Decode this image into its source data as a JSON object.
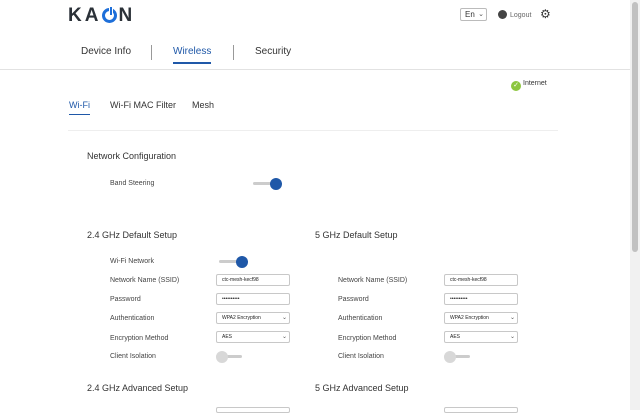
{
  "header": {
    "logo_text_1": "KA",
    "logo_text_2": "N",
    "language": "En",
    "logout": "Logout"
  },
  "nav": {
    "tabs": [
      "Device Info",
      "Wireless",
      "Security"
    ]
  },
  "status": {
    "internet": "Internet"
  },
  "subtabs": [
    "Wi-Fi",
    "Wi-Fi MAC Filter",
    "Mesh"
  ],
  "network_config": {
    "title": "Network Configuration",
    "band_steering_label": "Band Steering",
    "band_steering_on": true
  },
  "ghz24_default": {
    "title": "2.4 GHz Default Setup",
    "wifi_network_label": "Wi-Fi Network",
    "wifi_network_on": true,
    "ssid_label": "Network Name (SSID)",
    "ssid_value": "ctc-mesh-kecf98",
    "password_label": "Password",
    "password_value": "••••••••••",
    "auth_label": "Authentication",
    "auth_value": "WPA2 Encryption",
    "enc_label": "Encryption Method",
    "enc_value": "AES",
    "isolation_label": "Client Isolation",
    "isolation_on": false
  },
  "ghz5_default": {
    "title": "5 GHz Default Setup",
    "ssid_label": "Network Name (SSID)",
    "ssid_value": "ctc-mesh-kecf98",
    "password_label": "Password",
    "password_value": "••••••••••",
    "auth_label": "Authentication",
    "auth_value": "WPA2 Encryption",
    "enc_label": "Encryption Method",
    "enc_value": "AES",
    "isolation_label": "Client Isolation",
    "isolation_on": false
  },
  "ghz24_advanced": {
    "title": "2.4 GHz Advanced Setup"
  },
  "ghz5_advanced": {
    "title": "5 GHz Advanced Setup"
  },
  "colors": {
    "accent": "#1f58a8",
    "internet_ok": "#8cc63e"
  }
}
